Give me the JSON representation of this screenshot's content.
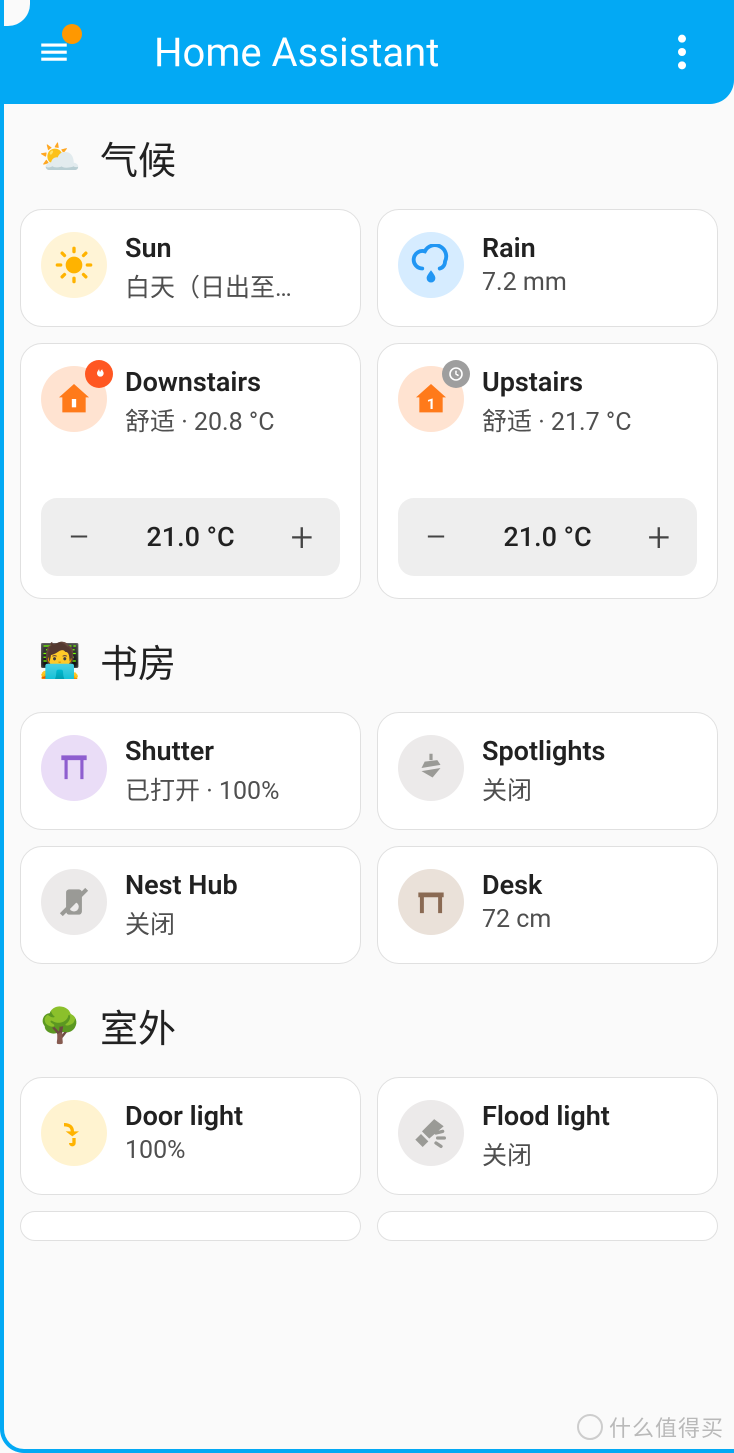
{
  "app": {
    "title": "Home Assistant"
  },
  "sections": {
    "climate": {
      "title": "气候",
      "sun": {
        "name": "Sun",
        "status": "白天（日出至…"
      },
      "rain": {
        "name": "Rain",
        "status": "7.2 mm"
      },
      "downstairs": {
        "name": "Downstairs",
        "status": "舒适 · 20.8 °C",
        "setpoint": "21.0 °C"
      },
      "upstairs": {
        "name": "Upstairs",
        "status": "舒适 · 21.7 °C",
        "setpoint": "21.0 °C"
      }
    },
    "study": {
      "title": "书房",
      "shutter": {
        "name": "Shutter",
        "status": "已打开 · 100%"
      },
      "spotlights": {
        "name": "Spotlights",
        "status": "关闭"
      },
      "nesthub": {
        "name": "Nest Hub",
        "status": "关闭"
      },
      "desk": {
        "name": "Desk",
        "status": "72 cm"
      }
    },
    "outdoor": {
      "title": "室外",
      "doorlight": {
        "name": "Door light",
        "status": "100%"
      },
      "floodlight": {
        "name": "Flood light",
        "status": "关闭"
      }
    }
  },
  "watermark": "什么值得买"
}
